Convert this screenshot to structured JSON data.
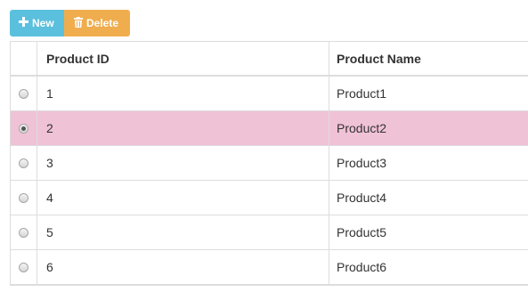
{
  "toolbar": {
    "new_icon": "plus-icon",
    "new_label": "New",
    "delete_icon": "trash-icon",
    "delete_label": "Delete"
  },
  "colors": {
    "new_button": "#5bc0de",
    "delete_button": "#f0ad4e",
    "selected_row": "#f0c2d6"
  },
  "table": {
    "columns": [
      "",
      "Product ID",
      "Product Name"
    ],
    "rows": [
      {
        "id": "1",
        "name": "Product1",
        "selected": false
      },
      {
        "id": "2",
        "name": "Product2",
        "selected": true
      },
      {
        "id": "3",
        "name": "Product3",
        "selected": false
      },
      {
        "id": "4",
        "name": "Product4",
        "selected": false
      },
      {
        "id": "5",
        "name": "Product5",
        "selected": false
      },
      {
        "id": "6",
        "name": "Product6",
        "selected": false
      }
    ]
  }
}
